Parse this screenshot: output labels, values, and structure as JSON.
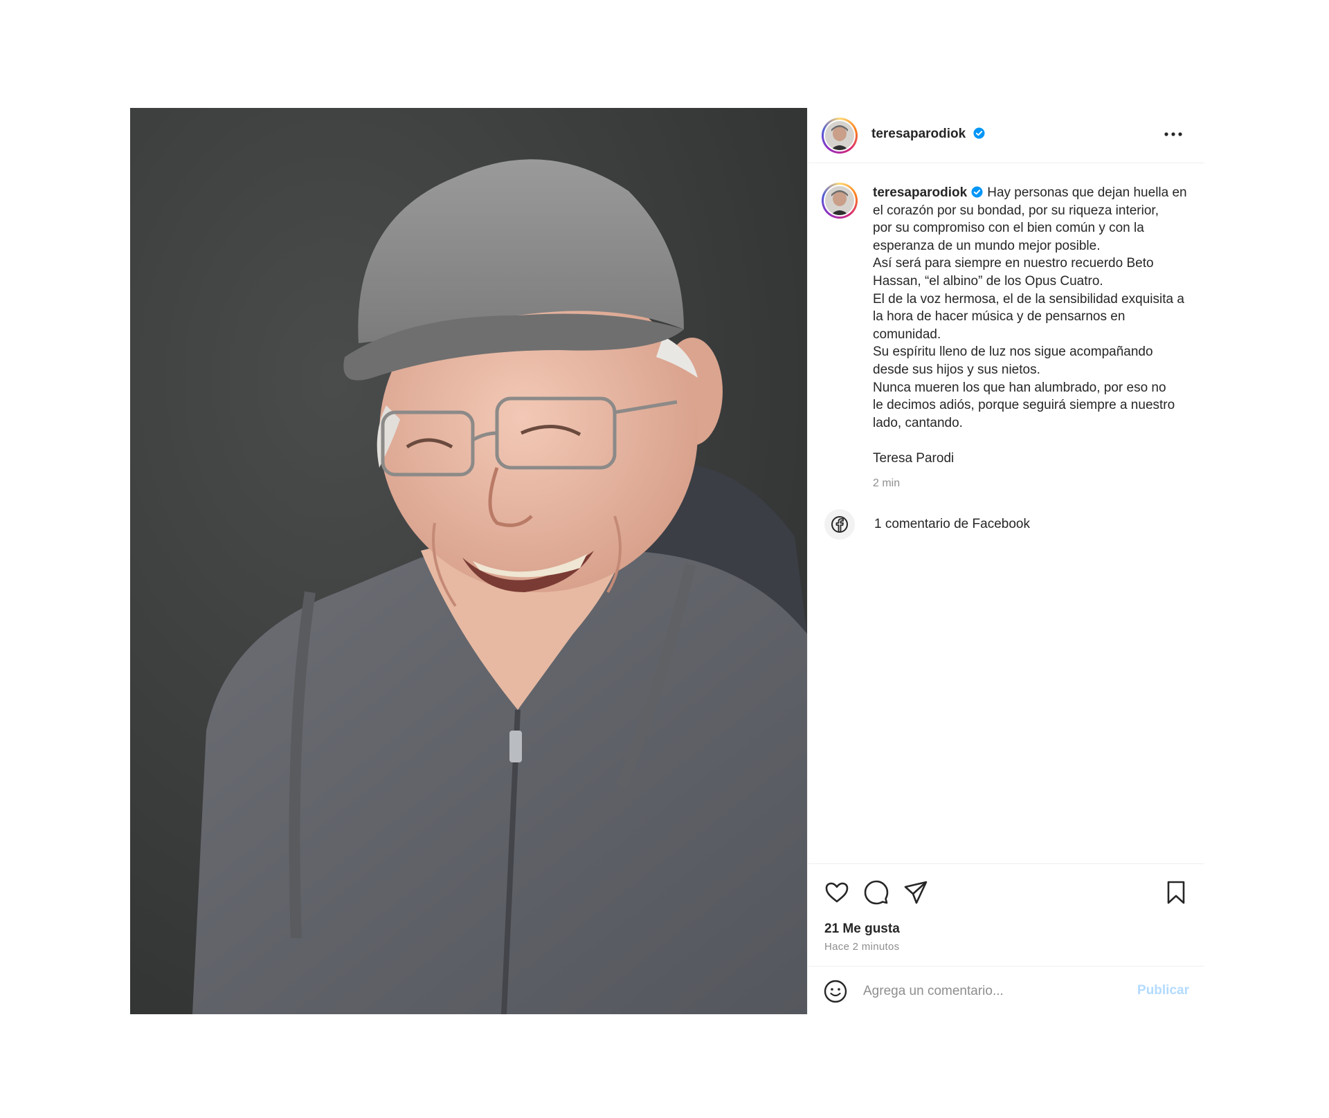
{
  "post": {
    "username": "teresaparodiok",
    "verified": true,
    "more_icon": "more-horizontal-icon",
    "photo_description_icon": "post-photo",
    "caption_lines": [
      "Hay personas que dejan huella en",
      "el corazón por su bondad, por su riqueza interior,",
      "por su compromiso con el bien común y con la",
      "esperanza de un mundo mejor posible.",
      "Así será para siempre en nuestro recuerdo Beto",
      "Hassan, “el albino” de los Opus Cuatro.",
      "El de la voz hermosa, el de la sensibilidad exquisita a",
      "la hora de hacer música y de pensarnos en",
      "comunidad.",
      "Su espíritu lleno de luz nos sigue acompañando",
      "desde sus hijos y sus nietos.",
      "Nunca mueren los que han alumbrado, por eso no",
      "le decimos adiós, porque seguirá siempre a nuestro",
      "lado, cantando."
    ],
    "signature": "Teresa Parodi",
    "caption_time": "2 min",
    "facebook_comments": "1 comentario de Facebook",
    "likes": "21 Me gusta",
    "posted_ago": "Hace 2 minutos",
    "comment_placeholder": "Agrega un comentario...",
    "publish_label": "Publicar"
  },
  "colors": {
    "verified_blue": "#0095f6",
    "publish_disabled": "#b3dbff",
    "secondary_text": "#8e8e8e",
    "border": "#efefef"
  }
}
